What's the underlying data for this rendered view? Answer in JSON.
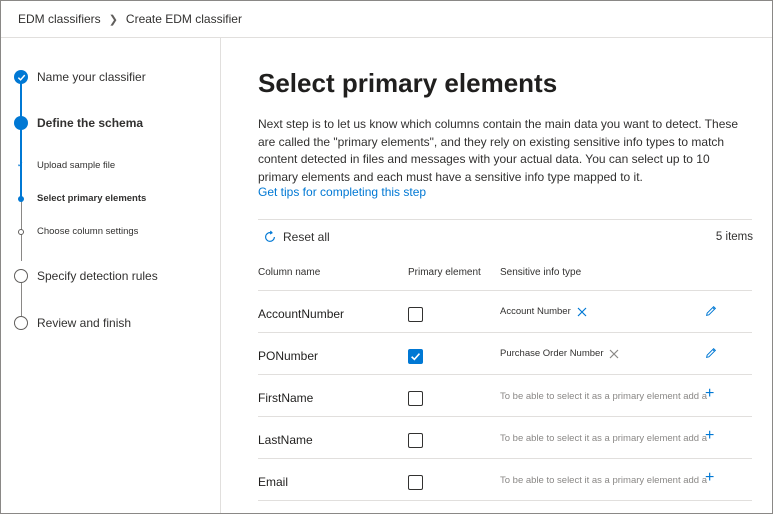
{
  "breadcrumb": {
    "items": [
      "EDM classifiers",
      "Create EDM classifier"
    ]
  },
  "sidebar": {
    "steps": [
      {
        "label": "Name your classifier",
        "state": "done"
      },
      {
        "label": "Define the schema",
        "state": "current"
      },
      {
        "label": "Specify detection rules",
        "state": "pending"
      },
      {
        "label": "Review and finish",
        "state": "pending"
      }
    ],
    "substeps": [
      {
        "label": "Upload sample file",
        "state": "done"
      },
      {
        "label": "Select primary elements",
        "state": "current"
      },
      {
        "label": "Choose column settings",
        "state": "pending"
      }
    ]
  },
  "main": {
    "title": "Select primary elements",
    "description": "Next step is to let us know which columns contain the main data you want to detect. These are called the \"primary elements\", and they rely on existing sensitive info types to match content detected in files and messages with your actual data. You can select up to 10 primary elements and each must have a sensitive info type mapped to it.",
    "tips_link": "Get tips for completing this step",
    "reset_label": "Reset all",
    "item_count": "5 items",
    "columns": {
      "name": "Column name",
      "primary": "Primary element",
      "info_type": "Sensitive info type"
    },
    "rows": [
      {
        "name": "AccountNumber",
        "primary": false,
        "info_type": "Account Number",
        "has_type": true
      },
      {
        "name": "PONumber",
        "primary": true,
        "info_type": "Purchase Order Number",
        "has_type": true
      },
      {
        "name": "FirstName",
        "primary": false,
        "info_type": "To be able to select it as a primary element add a",
        "has_type": false
      },
      {
        "name": "LastName",
        "primary": false,
        "info_type": "To be able to select it as a primary element add a",
        "has_type": false
      },
      {
        "name": "Email",
        "primary": false,
        "info_type": "To be able to select it as a primary element add a",
        "has_type": false
      }
    ]
  },
  "colors": {
    "accent": "#0078d4",
    "text": "#323130",
    "border": "#e1dfdd"
  }
}
